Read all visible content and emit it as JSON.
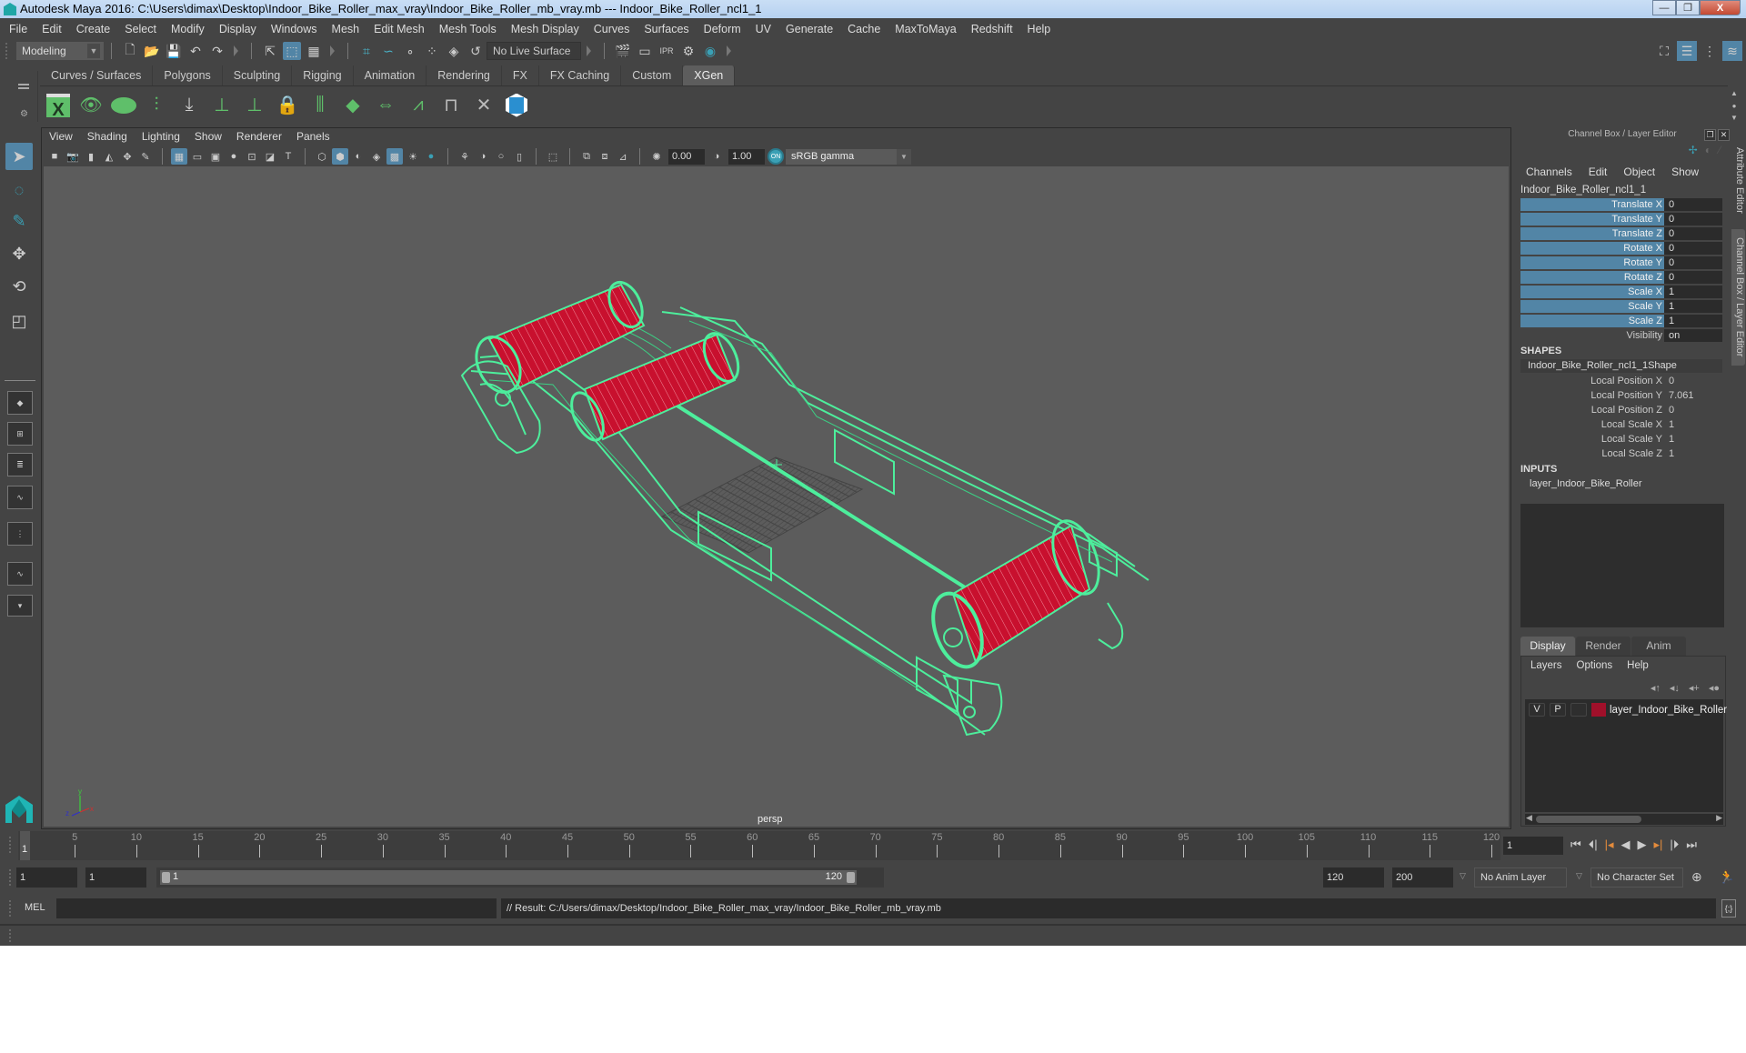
{
  "window": {
    "title": "Autodesk Maya 2016: C:\\Users\\dimax\\Desktop\\Indoor_Bike_Roller_max_vray\\Indoor_Bike_Roller_mb_vray.mb   ---   Indoor_Bike_Roller_ncl1_1",
    "minimize": "—",
    "restore": "❐",
    "close": "X"
  },
  "menubar": [
    "File",
    "Edit",
    "Create",
    "Select",
    "Modify",
    "Display",
    "Windows",
    "Mesh",
    "Edit Mesh",
    "Mesh Tools",
    "Mesh Display",
    "Curves",
    "Surfaces",
    "Deform",
    "UV",
    "Generate",
    "Cache",
    "MaxToMaya",
    "Redshift",
    "Help"
  ],
  "statusline": {
    "mode": "Modeling",
    "live_surface": "No Live Surface",
    "icons": [
      "new-scene-icon",
      "open-scene-icon",
      "save-scene-icon",
      "undo-icon",
      "redo-icon"
    ]
  },
  "shelf": {
    "tabs": [
      "Curves / Surfaces",
      "Polygons",
      "Sculpting",
      "Rigging",
      "Animation",
      "Rendering",
      "FX",
      "FX Caching",
      "Custom",
      "XGen"
    ],
    "active_tab": "XGen",
    "icons": [
      "xgen-editor-icon",
      "show-xgen-icon",
      "hide-xgen-icon",
      "add-guides-icon",
      "place-guides-icon",
      "add-guide-icon",
      "guide-visibility-icon",
      "lock-guide-icon",
      "split-guide-icon",
      "sculpt-guides-icon",
      "guide-length-icon",
      "select-guides-icon",
      "deselect-guides-icon",
      "delete-guide-icon",
      "xgen-logo-icon"
    ]
  },
  "viewport": {
    "menu": [
      "View",
      "Shading",
      "Lighting",
      "Show",
      "Renderer",
      "Panels"
    ],
    "exposure": "0.00",
    "gamma": "1.00",
    "color_space": "sRGB gamma",
    "camera_label": "persp",
    "axis": {
      "x": "x",
      "y": "y",
      "z": "z"
    }
  },
  "channel_box": {
    "header": "Channel Box / Layer Editor",
    "menu": [
      "Channels",
      "Edit",
      "Object",
      "Show"
    ],
    "object_name": "Indoor_Bike_Roller_ncl1_1",
    "channels": [
      {
        "label": "Translate X",
        "value": "0"
      },
      {
        "label": "Translate Y",
        "value": "0"
      },
      {
        "label": "Translate Z",
        "value": "0"
      },
      {
        "label": "Rotate X",
        "value": "0"
      },
      {
        "label": "Rotate Y",
        "value": "0"
      },
      {
        "label": "Rotate Z",
        "value": "0"
      },
      {
        "label": "Scale X",
        "value": "1"
      },
      {
        "label": "Scale Y",
        "value": "1"
      },
      {
        "label": "Scale Z",
        "value": "1"
      },
      {
        "label": "Visibility",
        "value": "on"
      }
    ],
    "shapes_header": "SHAPES",
    "shape_name": "Indoor_Bike_Roller_ncl1_1Shape",
    "shape_attrs": [
      {
        "label": "Local Position X",
        "value": "0"
      },
      {
        "label": "Local Position Y",
        "value": "7.061"
      },
      {
        "label": "Local Position Z",
        "value": "0"
      },
      {
        "label": "Local Scale X",
        "value": "1"
      },
      {
        "label": "Local Scale Y",
        "value": "1"
      },
      {
        "label": "Local Scale Z",
        "value": "1"
      }
    ],
    "inputs_header": "INPUTS",
    "input_name": "layer_Indoor_Bike_Roller"
  },
  "layer_editor": {
    "tabs": [
      "Display",
      "Render",
      "Anim"
    ],
    "active_tab": "Display",
    "menu": [
      "Layers",
      "Options",
      "Help"
    ],
    "layers": [
      {
        "visible": "V",
        "playback": "P",
        "name": "layer_Indoor_Bike_Roller",
        "color": "#a0102a"
      }
    ]
  },
  "side_tabs": [
    "Attribute Editor",
    "Channel Box / Layer Editor"
  ],
  "time_slider": {
    "ticks": [
      5,
      10,
      15,
      20,
      25,
      30,
      35,
      40,
      45,
      50,
      55,
      60,
      65,
      70,
      75,
      80,
      85,
      90,
      95,
      100,
      105,
      110,
      115,
      120
    ],
    "range": [
      1,
      120
    ],
    "current_frame_marker": "1",
    "current_frame": "1"
  },
  "range_slider": {
    "start": "1",
    "playback_start": "1",
    "range_start_label": "1",
    "range_end_label": "120",
    "playback_end": "120",
    "end": "200",
    "anim_layer": "No Anim Layer",
    "character_set": "No Character Set"
  },
  "command_line": {
    "label": "MEL",
    "input": "",
    "result": "// Result: C:/Users/dimax/Desktop/Indoor_Bike_Roller_max_vray/Indoor_Bike_Roller_mb_vray.mb"
  },
  "colors": {
    "accent": "#5285a6",
    "wireframe": "#4dee9c",
    "roller": "#c0102e",
    "viewport_bg": "#5c5c5c"
  }
}
